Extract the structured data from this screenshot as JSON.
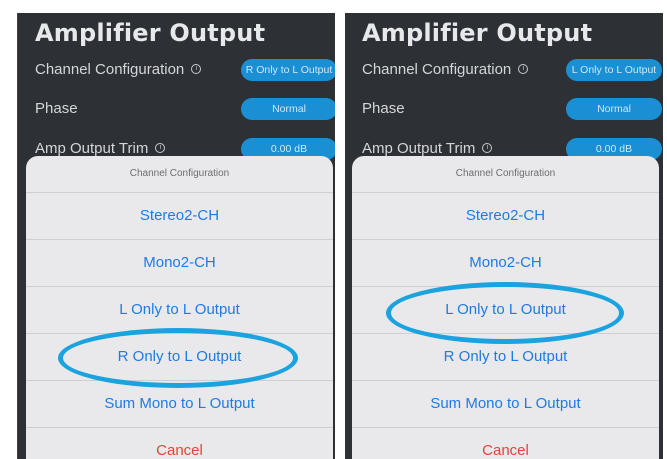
{
  "panels": [
    {
      "title": "Amplifier Output",
      "settings": {
        "channel_configuration": {
          "label": "Channel Configuration",
          "info": "i",
          "value": "R Only to L Output"
        },
        "phase": {
          "label": "Phase",
          "value": "Normal"
        },
        "amp_output_trim": {
          "label": "Amp Output Trim",
          "info": "i",
          "value": "0.00 dB"
        }
      },
      "sheet": {
        "title": "Channel Configuration",
        "options": [
          "Stereo2-CH",
          "Mono2-CH",
          "L Only to L Output",
          "R Only to L Output",
          "Sum Mono to L Output"
        ],
        "cancel": "Cancel",
        "highlighted_option": "R Only to L Output"
      }
    },
    {
      "title": "Amplifier Output",
      "settings": {
        "channel_configuration": {
          "label": "Channel Configuration",
          "info": "i",
          "value": "L Only to L Output"
        },
        "phase": {
          "label": "Phase",
          "value": "Normal"
        },
        "amp_output_trim": {
          "label": "Amp Output Trim",
          "info": "i",
          "value": "0.00 dB"
        }
      },
      "sheet": {
        "title": "Channel Configuration",
        "options": [
          "Stereo2-CH",
          "Mono2-CH",
          "L Only to L Output",
          "R Only to L Output",
          "Sum Mono to L Output"
        ],
        "cancel": "Cancel",
        "highlighted_option": "L Only to L Output"
      }
    }
  ],
  "colors": {
    "background": "#2d3035",
    "pill": "#1b8fd3",
    "option_text": "#1e7be4",
    "cancel_text": "#e8403a",
    "highlight_ring": "#1aa3de",
    "sheet": "#e9e9eb"
  }
}
